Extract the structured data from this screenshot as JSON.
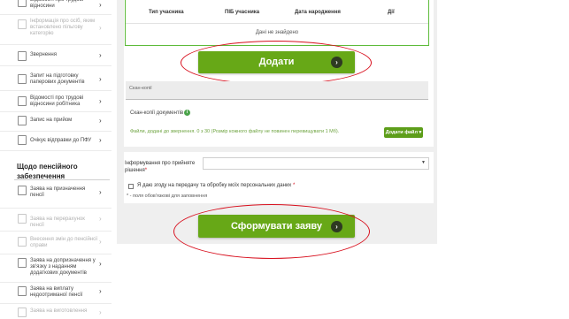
{
  "sidebar": {
    "items": [
      {
        "label": "Відомості про трудові відносини",
        "faded": false
      },
      {
        "label": "Інформація про осіб, яким встановлено пільгову категорію",
        "faded": true
      },
      {
        "label": "Звернення",
        "faded": false
      },
      {
        "label": "Запит на підготовку паперових документів",
        "faded": false
      },
      {
        "label": "Відомості про трудові відносини робітника",
        "faded": false
      },
      {
        "label": "Запис на прийом",
        "faded": false
      },
      {
        "label": "Очікує відправки до ПФУ",
        "faded": false
      }
    ],
    "section_title": "Щодо пенсійного забезпечення",
    "section_items": [
      {
        "label": "Заява на призначення пенсії",
        "faded": false
      },
      {
        "label": "Заява на перерахунок пенсії",
        "faded": true
      },
      {
        "label": "Внесення змін до пенсійної справи",
        "faded": true
      },
      {
        "label": "Заява на допризначення у зв'язку з наданням додаткових документів",
        "faded": false
      },
      {
        "label": "Заява на виплату недоотриманої пенсії",
        "faded": false
      },
      {
        "label": "Заява на виготовлення",
        "faded": true
      }
    ]
  },
  "participants_table": {
    "headers": [
      "Тип учасника",
      "ПІБ учасника",
      "Дата народження",
      "Дії"
    ],
    "empty_text": "Дані не знайдено"
  },
  "add_button": {
    "label": "Додати"
  },
  "scans": {
    "box_label": "Скан-копії",
    "label": "Скан-копії документів",
    "files_info": "Файли, додані до звернення. 0 з 30 (Розмір кожного файлу не повинен перевищувати 1 Мб).",
    "add_file_label": "Додати файл ▾"
  },
  "decision": {
    "label": "Інформування про прийняте рішення",
    "required_mark": "*",
    "selected_value": ""
  },
  "consent": {
    "text": "Я даю згоду на передачу та обробку моїх персональних даних",
    "required_mark": "*"
  },
  "required_note": "* - поля обов'язкові для заповнення",
  "submit_button": {
    "label": "Сформувати заяву"
  },
  "colors": {
    "accent_green": "#67a817",
    "annotation_red": "#d8101e",
    "info_green": "#6da33f"
  },
  "icons": {
    "arrow": "chevron-right-icon",
    "info": "info-icon",
    "sidebar_doc": "document-icon"
  }
}
